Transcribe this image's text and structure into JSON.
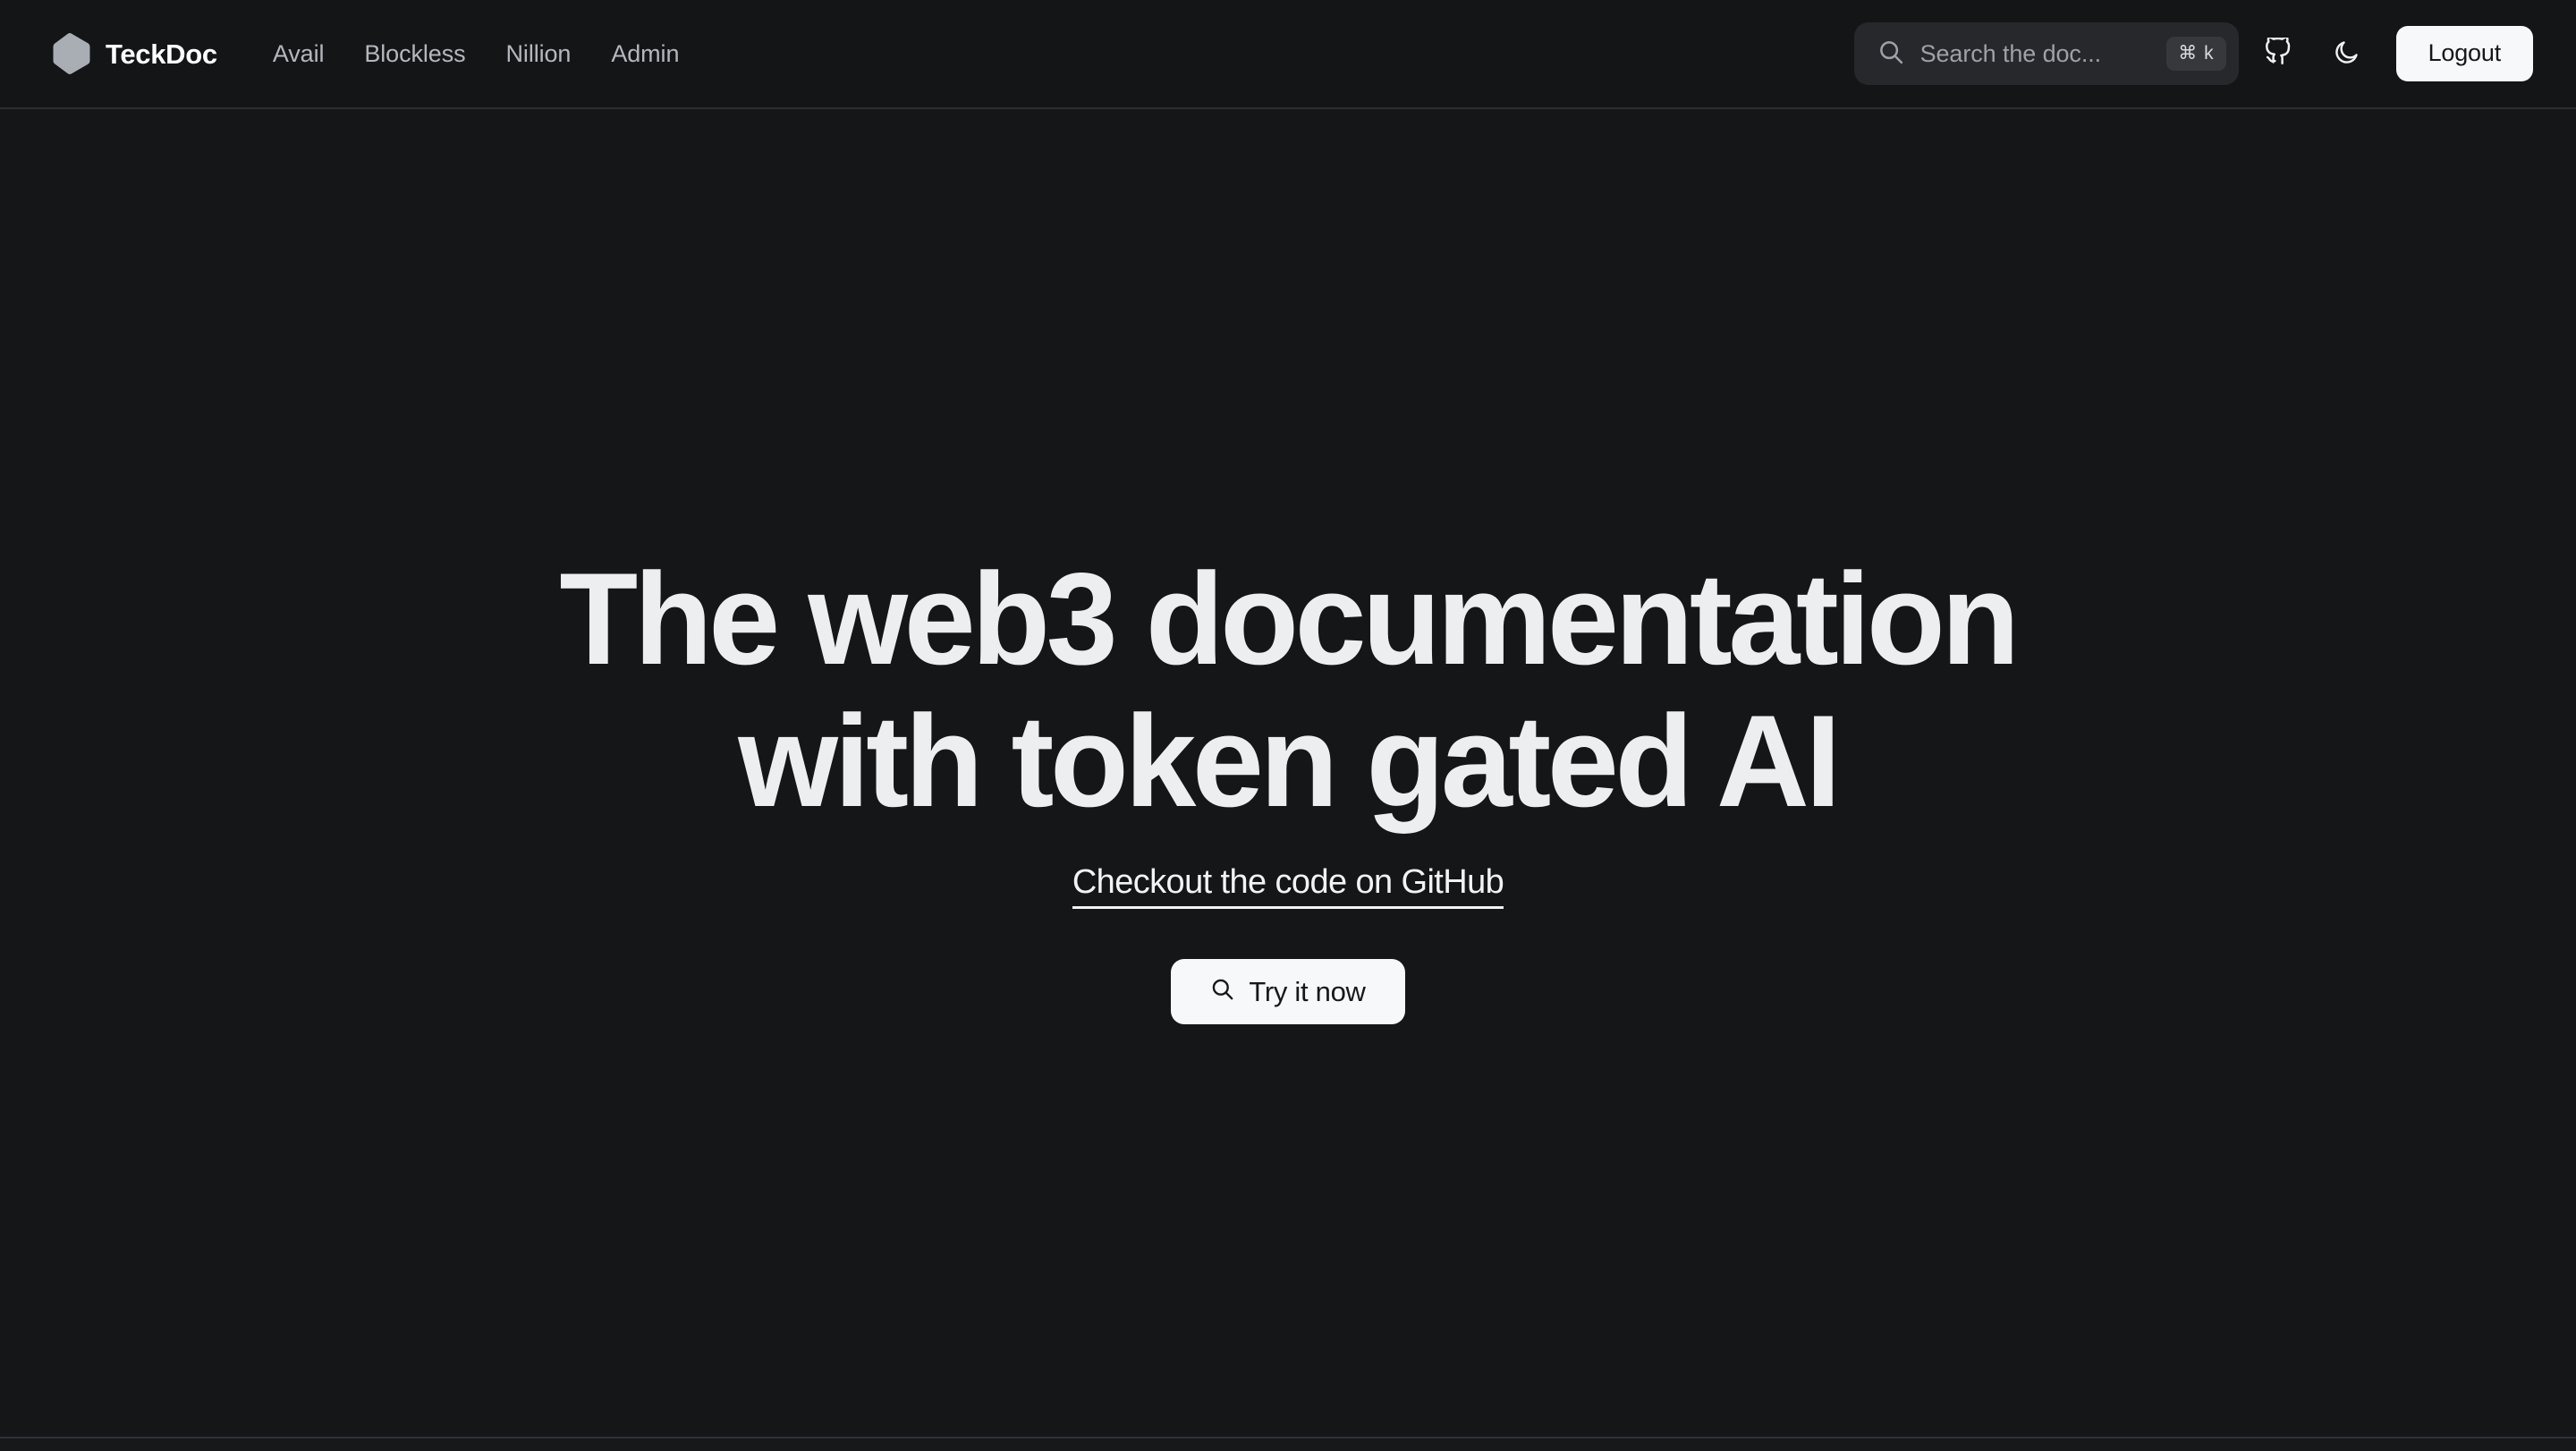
{
  "header": {
    "brand": {
      "name": "TeckDoc",
      "logo_icon": "hexagon-logo-icon",
      "logo_color": "#a9adb4"
    },
    "nav": [
      {
        "label": "Avail"
      },
      {
        "label": "Blockless"
      },
      {
        "label": "Nillion"
      },
      {
        "label": "Admin"
      }
    ],
    "search": {
      "placeholder": "Search the doc...",
      "value": "",
      "icon": "search-icon",
      "shortcut": "⌘ k"
    },
    "github_icon": "github-icon",
    "theme_toggle_icon": "moon-icon",
    "logout_label": "Logout"
  },
  "hero": {
    "title_line1": "The web3 documentation",
    "title_line2": "with token gated AI",
    "link_label": "Checkout the code on GitHub",
    "cta_label": "Try it now",
    "cta_icon": "search-icon"
  },
  "colors": {
    "page_background": "#151618",
    "header_background": "#141517",
    "header_border": "#2b2d30",
    "search_background": "#26282b",
    "kbd_background": "#36383c",
    "nav_text": "#b4b7bd",
    "heading_text": "#eceef0",
    "accent_button": "#f7f8f9",
    "button_text": "#16181a",
    "footer_rule": "#303236"
  }
}
